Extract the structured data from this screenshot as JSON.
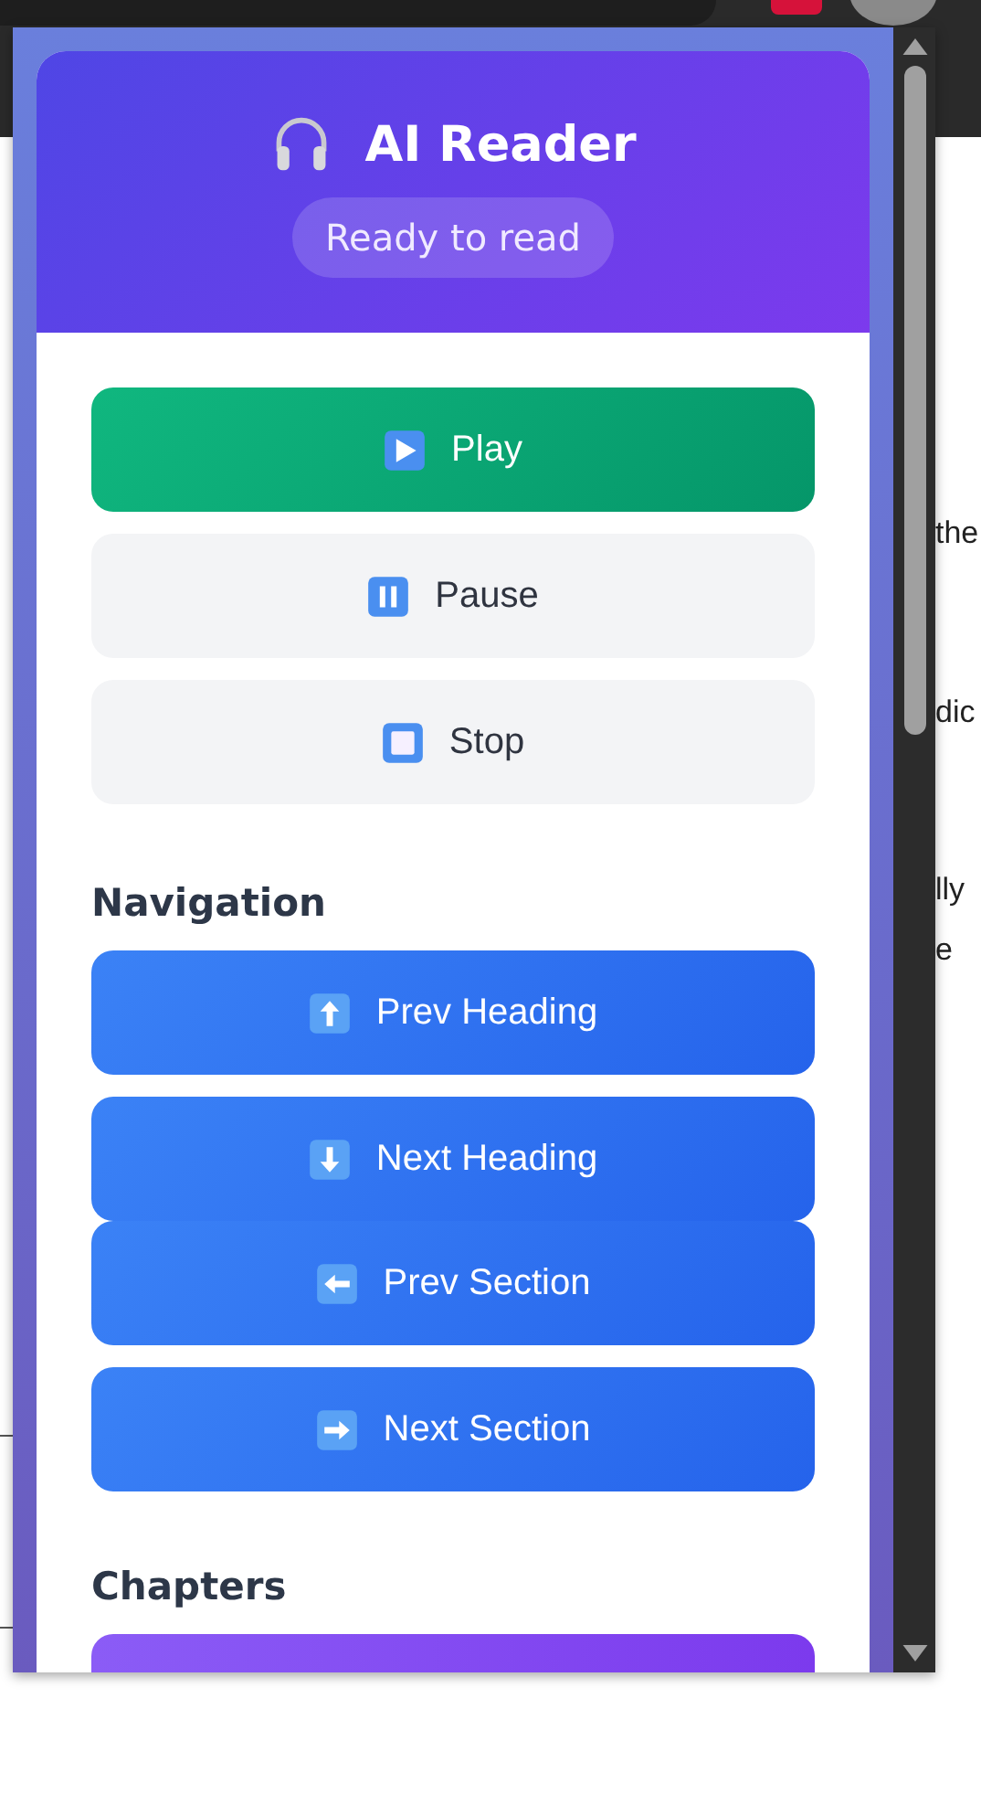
{
  "page_fragments": [
    "the",
    "dic",
    "lly",
    "e"
  ],
  "popup": {
    "title": "AI Reader",
    "status": "Ready to read",
    "controls": [
      {
        "kind": "play",
        "label": "Play"
      },
      {
        "kind": "pause",
        "label": "Pause"
      },
      {
        "kind": "stop",
        "label": "Stop"
      }
    ],
    "navigation": {
      "heading": "Navigation",
      "buttons": [
        {
          "kind": "up",
          "label": "Prev Heading"
        },
        {
          "kind": "down",
          "label": "Next Heading"
        },
        {
          "kind": "left",
          "label": "Prev Section"
        },
        {
          "kind": "right",
          "label": "Next Section"
        }
      ]
    },
    "chapters": {
      "heading": "Chapters"
    }
  }
}
